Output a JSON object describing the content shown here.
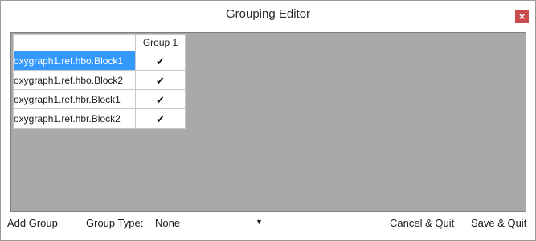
{
  "window": {
    "title": "Grouping Editor",
    "close_glyph": "×"
  },
  "grid": {
    "columns": [
      "Group 1"
    ],
    "rows": [
      {
        "label": "oxygraph1.ref.hbo.Block1",
        "checked": true,
        "selected": true
      },
      {
        "label": "oxygraph1.ref.hbo.Block2",
        "checked": true,
        "selected": false
      },
      {
        "label": "oxygraph1.ref.hbr.Block1",
        "checked": true,
        "selected": false
      },
      {
        "label": "oxygraph1.ref.hbr.Block2",
        "checked": true,
        "selected": false
      }
    ],
    "check_glyph": "✔"
  },
  "toolbar": {
    "add_group": "Add Group",
    "group_type_label": "Group Type:",
    "group_type_value": "None",
    "dropdown_arrow": "▼",
    "cancel_quit": "Cancel & Quit",
    "save_quit": "Save & Quit"
  },
  "colors": {
    "selection": "#3399ff",
    "grid_background": "#a9a9a9",
    "close_button": "#c94b4b"
  },
  "icons": {
    "close": "close-icon",
    "checkbox": "check-icon",
    "dropdown": "chevron-down-icon"
  }
}
